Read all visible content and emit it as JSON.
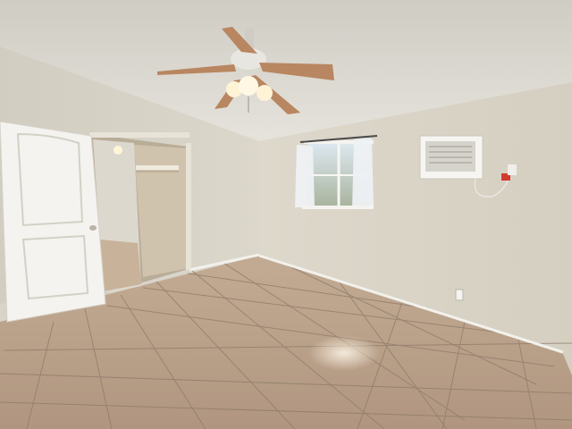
{
  "scene": {
    "room": "empty-bedroom",
    "objects": [
      "ceiling-fan",
      "six-panel-door",
      "open-closet-with-mirror-door",
      "window-with-sheer-curtains",
      "wall-air-conditioner",
      "wall-outlet",
      "beige-floor-tiles",
      "white-baseboards"
    ]
  },
  "colors": {
    "ceiling": "#e4e1d9",
    "wall_back": "#dcd6c8",
    "wall_left": "#d6d1c5",
    "floor": "#b99f86",
    "grout": "#8c7a68",
    "door": "#f4f3ef",
    "fan_blade": "#b88660",
    "baseboard": "#f2f1ec"
  }
}
